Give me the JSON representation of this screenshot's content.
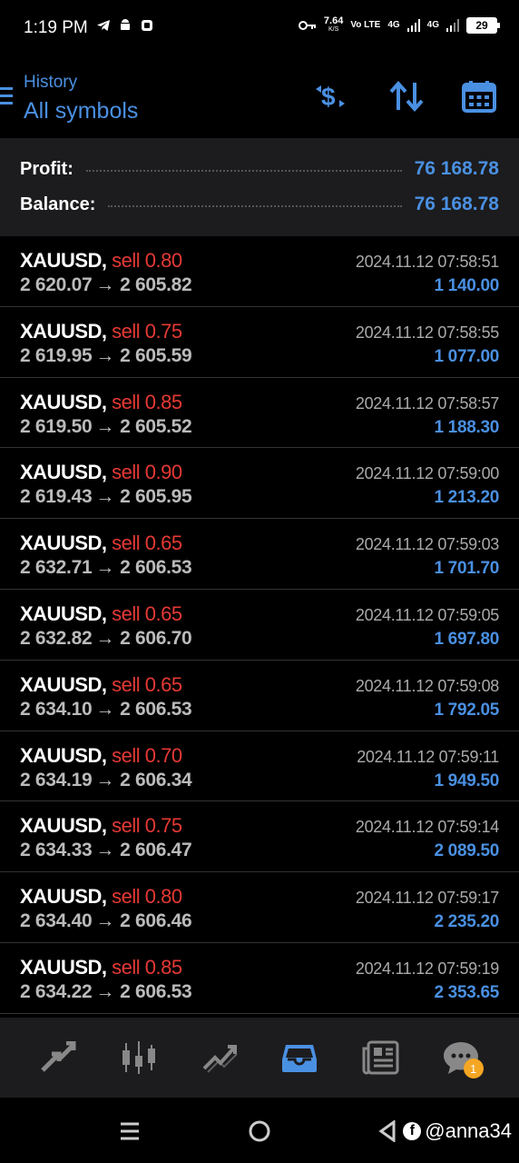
{
  "status_bar": {
    "time": "1:19 PM",
    "speed_value": "7.64",
    "speed_unit": "K/S",
    "volte": "Vo LTE",
    "net1": "4G",
    "net2": "4G",
    "battery": "29"
  },
  "header": {
    "subtitle": "History",
    "title": "All symbols",
    "icons": [
      "dollar-refresh-icon",
      "sort-icon",
      "calendar-icon"
    ]
  },
  "summary": {
    "profit_label": "Profit:",
    "profit_value": "76 168.78",
    "balance_label": "Balance:",
    "balance_value": "76 168.78"
  },
  "trades": [
    {
      "symbol": "XAUUSD,",
      "side": "sell 0.80",
      "open": "2 620.07",
      "close": "2 605.82",
      "time": "2024.11.12 07:58:51",
      "profit": "1 140.00"
    },
    {
      "symbol": "XAUUSD,",
      "side": "sell 0.75",
      "open": "2 619.95",
      "close": "2 605.59",
      "time": "2024.11.12 07:58:55",
      "profit": "1 077.00"
    },
    {
      "symbol": "XAUUSD,",
      "side": "sell 0.85",
      "open": "2 619.50",
      "close": "2 605.52",
      "time": "2024.11.12 07:58:57",
      "profit": "1 188.30"
    },
    {
      "symbol": "XAUUSD,",
      "side": "sell 0.90",
      "open": "2 619.43",
      "close": "2 605.95",
      "time": "2024.11.12 07:59:00",
      "profit": "1 213.20"
    },
    {
      "symbol": "XAUUSD,",
      "side": "sell 0.65",
      "open": "2 632.71",
      "close": "2 606.53",
      "time": "2024.11.12 07:59:03",
      "profit": "1 701.70"
    },
    {
      "symbol": "XAUUSD,",
      "side": "sell 0.65",
      "open": "2 632.82",
      "close": "2 606.70",
      "time": "2024.11.12 07:59:05",
      "profit": "1 697.80"
    },
    {
      "symbol": "XAUUSD,",
      "side": "sell 0.65",
      "open": "2 634.10",
      "close": "2 606.53",
      "time": "2024.11.12 07:59:08",
      "profit": "1 792.05"
    },
    {
      "symbol": "XAUUSD,",
      "side": "sell 0.70",
      "open": "2 634.19",
      "close": "2 606.34",
      "time": "2024.11.12 07:59:11",
      "profit": "1 949.50"
    },
    {
      "symbol": "XAUUSD,",
      "side": "sell 0.75",
      "open": "2 634.33",
      "close": "2 606.47",
      "time": "2024.11.12 07:59:14",
      "profit": "2 089.50"
    },
    {
      "symbol": "XAUUSD,",
      "side": "sell 0.80",
      "open": "2 634.40",
      "close": "2 606.46",
      "time": "2024.11.12 07:59:17",
      "profit": "2 235.20"
    },
    {
      "symbol": "XAUUSD,",
      "side": "sell 0.85",
      "open": "2 634.22",
      "close": "2 606.53",
      "time": "2024.11.12 07:59:19",
      "profit": "2 353.65"
    }
  ],
  "bottom_nav": {
    "items": [
      "quotes-icon",
      "chart-icon",
      "trade-icon",
      "history-icon",
      "news-icon",
      "messages-icon"
    ],
    "active": "history-icon",
    "messages_badge": "1"
  },
  "system_nav": {
    "watermark": "@anna34"
  },
  "colors": {
    "accent": "#4a90e2",
    "sell": "#e53935",
    "badge": "#f5a623"
  }
}
